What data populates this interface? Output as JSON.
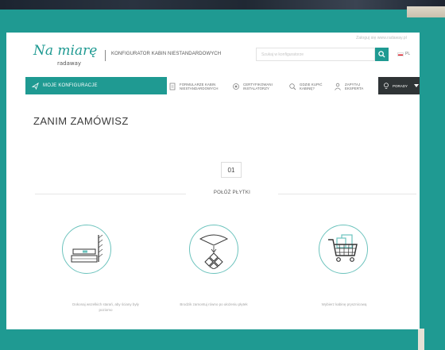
{
  "header": {
    "login_link": "Zaloguj się www.radaway.pl",
    "logo_main": "Na miarę",
    "logo_sub": "radaway",
    "tagline": "KONFIGURATOR KABIN NIESTANDARDOWYCH",
    "search_placeholder": "Szukaj w konfiguratorze",
    "language": "PL"
  },
  "nav": {
    "my_configs": "MOJE KONFIGURACJE",
    "items": [
      {
        "icon": "form-icon",
        "label_1": "FORMULARZE KABIN",
        "label_2": "NIESTANDARDOWYCH"
      },
      {
        "icon": "certificate-icon",
        "label_1": "CERTYFIKOWANI",
        "label_2": "INSTALATORZY"
      },
      {
        "icon": "search-store-icon",
        "label_1": "GDZIE KUPIĆ",
        "label_2": "KABINĘ?"
      },
      {
        "icon": "expert-icon",
        "label_1": "ZAPYTAJ",
        "label_2": "EKSPERTA"
      }
    ],
    "tips": "PORADY"
  },
  "main": {
    "title": "ZANIM ZAMÓWISZ",
    "step_number": "01",
    "step_title": "POŁÓŻ PŁYTKI",
    "steps": [
      {
        "icon": "level-icon",
        "caption_1": "Dokonaj wszelkich starań, aby ściany były",
        "caption_2": "poziomo"
      },
      {
        "icon": "tiles-icon",
        "caption_1": "Brodzik zamontuj równo po ułożeniu płytek",
        "caption_2": ""
      },
      {
        "icon": "cart-icon",
        "caption_1": "Wybierz kabinę prysznicową",
        "caption_2": ""
      }
    ]
  },
  "colors": {
    "teal": "#1f9a92",
    "dark_button": "#2f3436",
    "circle_border": "#6cc3bd"
  }
}
